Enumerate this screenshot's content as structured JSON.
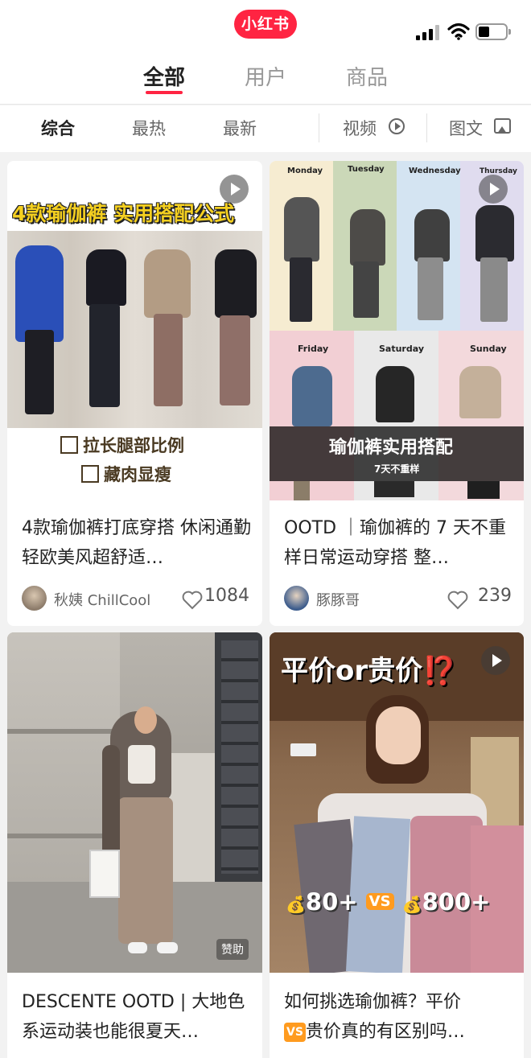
{
  "status_bar": {
    "logo": "小红书"
  },
  "tabs": [
    {
      "label": "全部"
    },
    {
      "label": "用户"
    },
    {
      "label": "商品"
    }
  ],
  "filters": [
    {
      "label": "综合"
    },
    {
      "label": "最热"
    },
    {
      "label": "最新"
    },
    {
      "label": "视频"
    },
    {
      "label": "图文"
    }
  ],
  "cards": [
    {
      "title": "4款瑜伽裤打底穿搭 休闲通勤轻欧美风超舒适…",
      "author": "秋姨 ChillCool",
      "likes": "1084",
      "cover_headline": "4款瑜伽裤 实用搭配公式",
      "cover_lines": [
        "拉长腿部比例",
        "藏肉显瘦"
      ]
    },
    {
      "title": "OOTD ｜瑜伽裤的 7 天不重样日常运动穿搭 整…",
      "author": "豚豚哥",
      "likes": "239",
      "cover_days": [
        "Monday",
        "Tuesday",
        "Wednesday",
        "Thursday",
        "Friday",
        "Saturday",
        "Sunday"
      ],
      "cover_headline": "瑜伽裤实用搭配",
      "cover_sub": "7天不重样"
    },
    {
      "title": "DESCENTE OOTD | 大地色系运动装也能很夏天…",
      "sponsor": "赞助"
    },
    {
      "title_prefix": "如何挑选瑜伽裤？平价",
      "vs": "VS",
      "title_suffix": "贵价真的有区别吗…",
      "cover_headline": "平价or贵价⁉️",
      "cover_price_low": "80+",
      "cover_price_high": "800+"
    }
  ],
  "colors": {
    "brand": "#ff2442",
    "accent_orange": "#ff9b1f"
  }
}
